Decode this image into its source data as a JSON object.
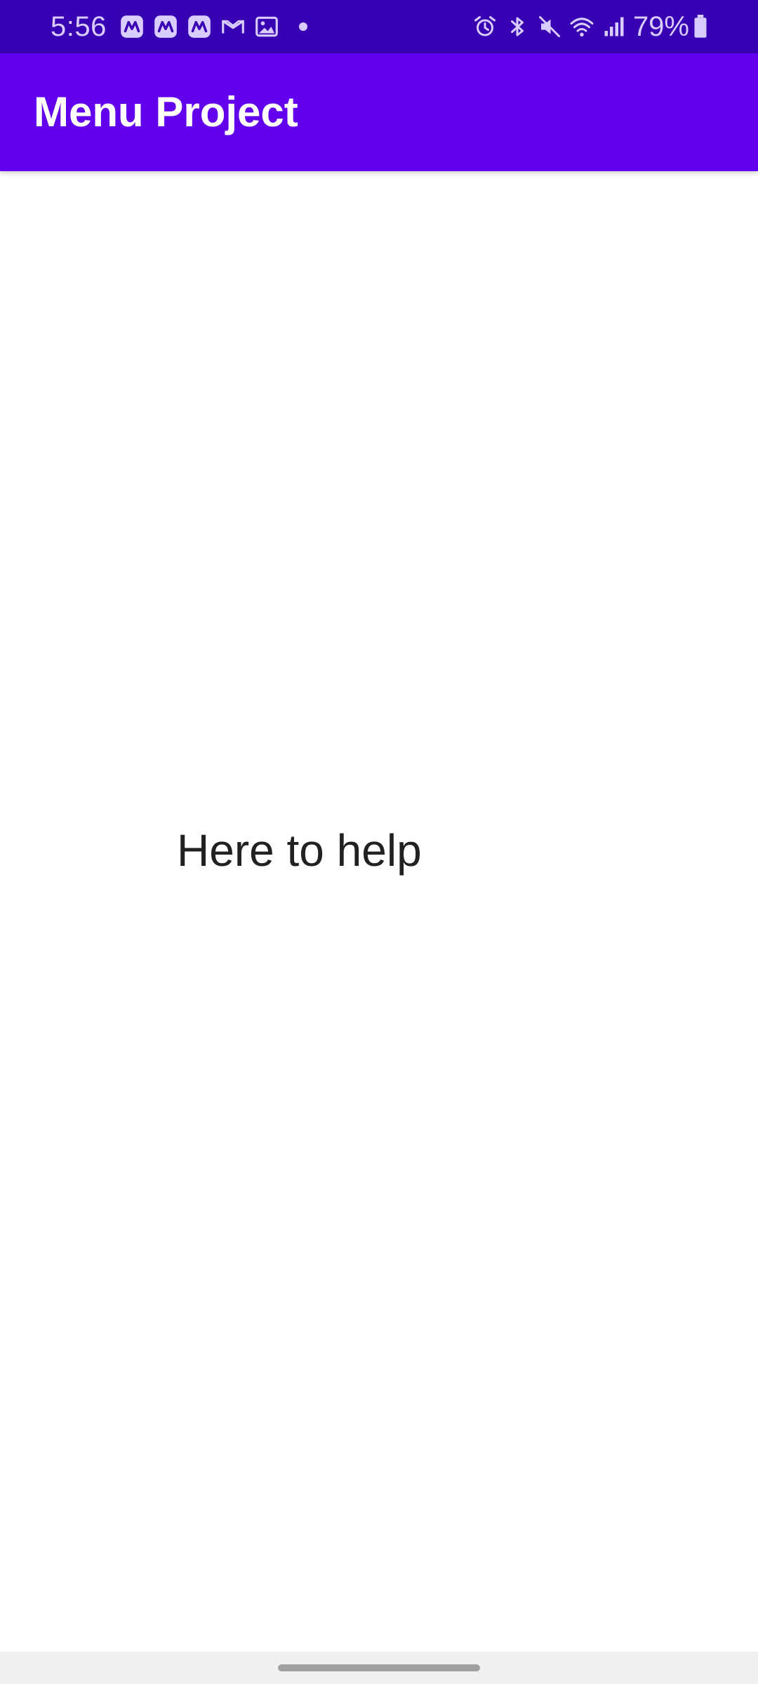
{
  "status_bar": {
    "time": "5:56",
    "battery_percent": "79%",
    "notification_icons": [
      "app-notification-icon",
      "app-notification-icon",
      "app-notification-icon",
      "gmail-icon",
      "gallery-icon",
      "more-notifications-dot"
    ],
    "system_icons": [
      "alarm-icon",
      "bluetooth-icon",
      "mute-icon",
      "wifi-icon",
      "signal-icon",
      "battery-icon"
    ],
    "background_color": "#3700b3"
  },
  "app_bar": {
    "title": "Menu Project",
    "background_color": "#6200ee"
  },
  "main": {
    "message": "Here to help"
  }
}
